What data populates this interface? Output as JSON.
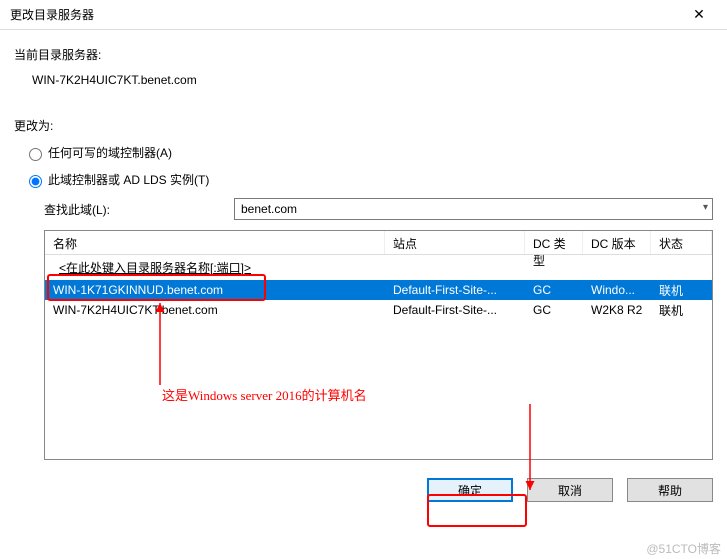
{
  "window": {
    "title": "更改目录服务器",
    "close": "✕"
  },
  "current": {
    "label": "当前目录服务器:",
    "value": "WIN-7K2H4UIC7KT.benet.com"
  },
  "changeTo": {
    "label": "更改为:"
  },
  "radios": {
    "anyWritable": {
      "label": "任何可写的域控制器(A)",
      "checked": false
    },
    "thisDC": {
      "label": "此域控制器或 AD LDS 实例(T)",
      "checked": true
    }
  },
  "lookup": {
    "label": "查找此域(L):",
    "value": "benet.com"
  },
  "grid": {
    "headers": {
      "name": "名称",
      "site": "站点",
      "dctype": "DC 类型",
      "dcver": "DC 版本",
      "status": "状态"
    },
    "hint": "<在此处键入目录服务器名称[:端口]>",
    "rows": [
      {
        "name": "WIN-1K71GKINNUD.benet.com",
        "site": "Default-First-Site-...",
        "dctype": "GC",
        "dcver": "Windo...",
        "status": "联机",
        "selected": true
      },
      {
        "name": "WIN-7K2H4UIC7KT.benet.com",
        "site": "Default-First-Site-...",
        "dctype": "GC",
        "dcver": "W2K8 R2",
        "status": "联机",
        "selected": false
      }
    ]
  },
  "buttons": {
    "ok": "确定",
    "cancel": "取消",
    "help": "帮助"
  },
  "annotation": {
    "text": "这是Windows server 2016的计算机名"
  },
  "watermark": "@51CTO博客"
}
